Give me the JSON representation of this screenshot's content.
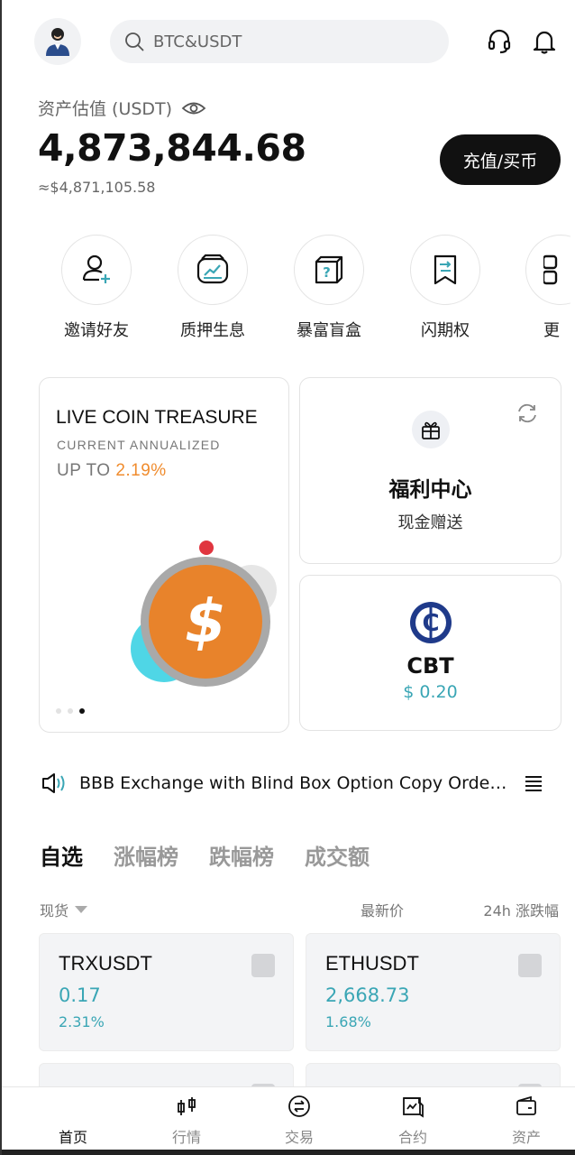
{
  "header": {
    "search_placeholder": "BTC&USDT"
  },
  "balance": {
    "label": "资产估值 (USDT)",
    "value": "4,873,844.68",
    "approx": "≈$4,871,105.58",
    "deposit_label": "充值/买币"
  },
  "quick_actions": [
    {
      "label": "邀请好友",
      "icon": "invite-user-icon"
    },
    {
      "label": "质押生息",
      "icon": "staking-chart-icon"
    },
    {
      "label": "暴富盲盒",
      "icon": "mystery-box-icon"
    },
    {
      "label": "闪期权",
      "icon": "flash-option-icon"
    },
    {
      "label": "更",
      "icon": "more-icon"
    }
  ],
  "promo": {
    "title": "LIVE COIN TREASURE",
    "subtitle": "CURRENT ANNUALIZED",
    "rate_prefix": "UP TO",
    "rate_value": "2.19%",
    "coin_symbol": "$"
  },
  "welfare": {
    "title": "福利中心",
    "subtitle": "现金赠送"
  },
  "cbt": {
    "name": "CBT",
    "price": "$ 0.20",
    "logo_letter": "C"
  },
  "announcement": {
    "text": "BBB Exchange with Blind Box Option Copy Order i..."
  },
  "market_tabs": [
    "自选",
    "涨幅榜",
    "跌幅榜",
    "成交额"
  ],
  "list_header": {
    "spot": "现货",
    "last_price": "最新价",
    "change": "24h 涨跌幅"
  },
  "tickers": [
    {
      "symbol": "TRXUSDT",
      "price": "0.17",
      "change": "2.31%"
    },
    {
      "symbol": "ETHUSDT",
      "price": "2,668.73",
      "change": "1.68%"
    }
  ],
  "bottom_nav": [
    {
      "label": "首页",
      "icon": "home-icon",
      "active": true
    },
    {
      "label": "行情",
      "icon": "market-candle-icon"
    },
    {
      "label": "交易",
      "icon": "trade-exchange-icon"
    },
    {
      "label": "合约",
      "icon": "contract-icon"
    },
    {
      "label": "资产",
      "icon": "wallet-icon"
    }
  ],
  "colors": {
    "accent_teal": "#3aa6b5",
    "accent_orange": "#f08c2e",
    "cbt_blue": "#1f3a8a",
    "dark": "#111111"
  }
}
